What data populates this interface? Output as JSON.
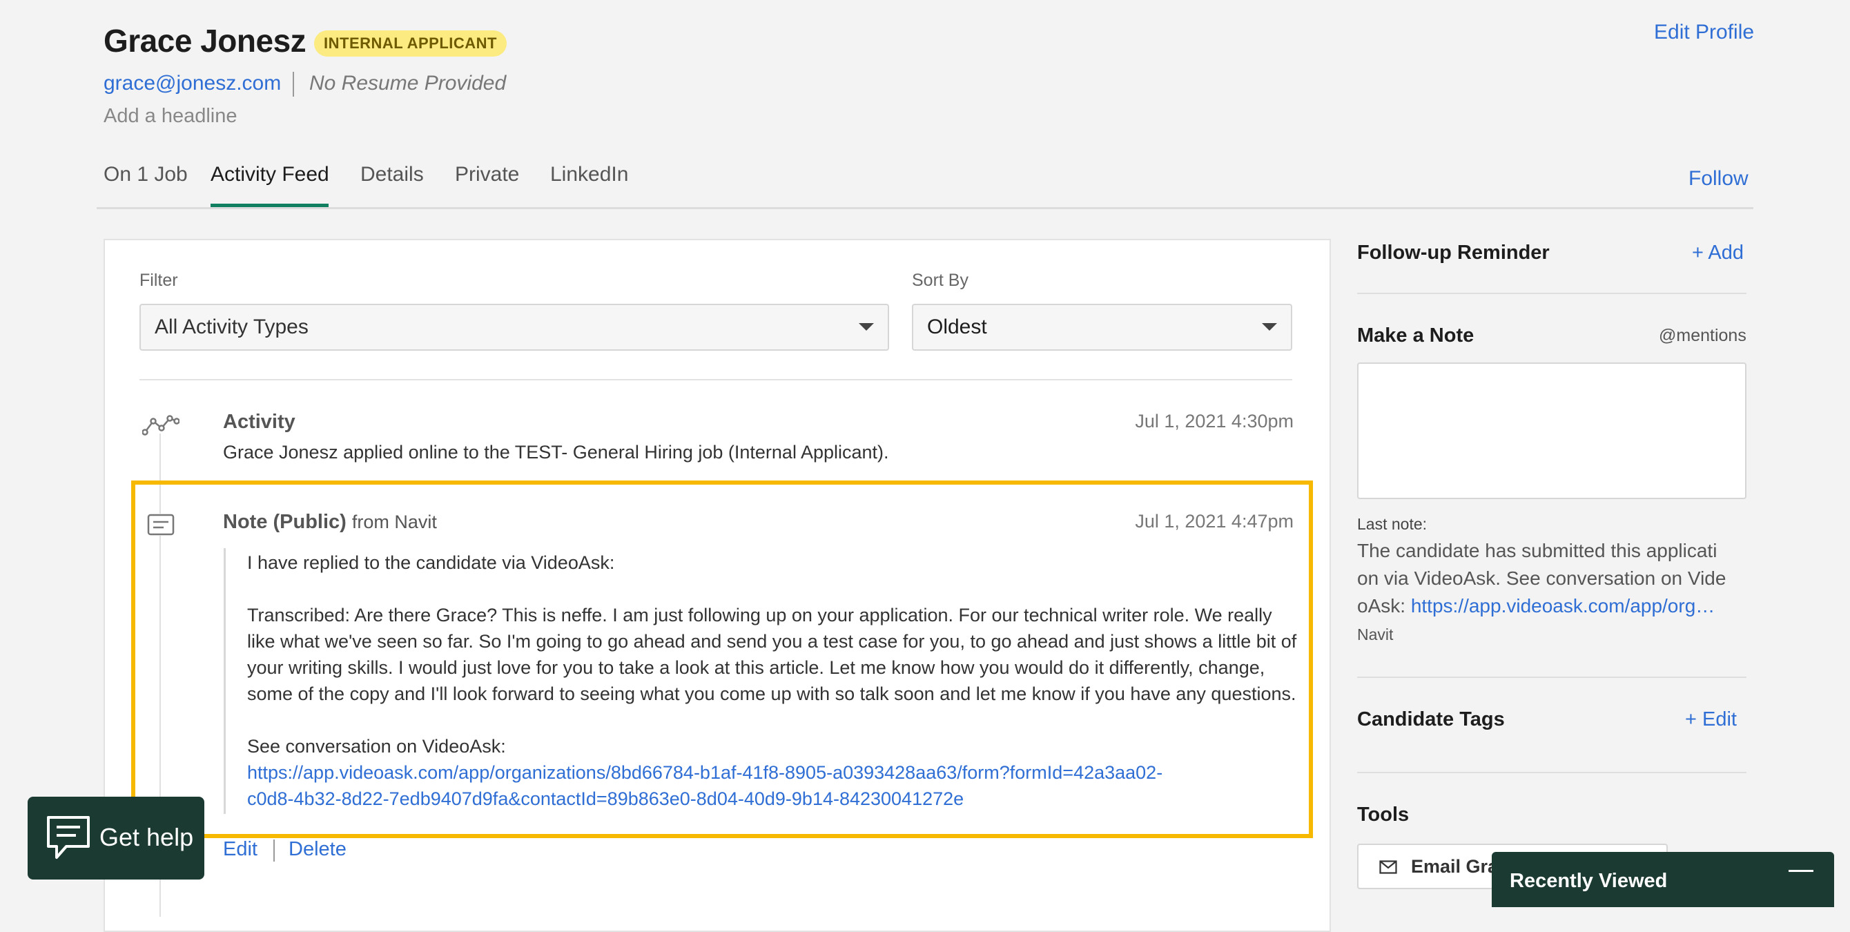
{
  "candidate": {
    "name": "Grace Jonesz",
    "badge": "INTERNAL APPLICANT",
    "email": "grace@jonesz.com",
    "resume_status": "No Resume Provided",
    "headline_placeholder": "Add a headline",
    "edit_profile": "Edit Profile"
  },
  "tabs": [
    {
      "label": "On 1 Job"
    },
    {
      "label": "Activity Feed",
      "active": true
    },
    {
      "label": "Details"
    },
    {
      "label": "Private"
    },
    {
      "label": "LinkedIn"
    }
  ],
  "follow": "Follow",
  "feed": {
    "filter_label": "Filter",
    "filter_value": "All Activity Types",
    "sort_label": "Sort By",
    "sort_value": "Oldest",
    "activity": {
      "title": "Activity",
      "timestamp": "Jul 1, 2021 4:30pm",
      "description": "Grace Jonesz applied online to the TEST- General Hiring job (Internal Applicant)."
    },
    "note": {
      "title": "Note (Public)",
      "from": "from Navit",
      "timestamp": "Jul 1, 2021 4:47pm",
      "lines": [
        "I have replied to the candidate via VideoAsk:",
        "Transcribed: Are there Grace? This is neffe. I am just following up on your application. For our technical writer role. We really",
        "like what we've seen so far. So I'm going to go ahead and send you a test case for you, to go ahead and just shows a little bit of",
        "your writing skills. I would just love for you to take a look at this article. Let me know how you would do it differently, change,",
        "some of the copy and I'll look forward to seeing what you come up with so talk soon and let me know if you have any questions.",
        "See conversation on VideoAsk:"
      ],
      "link_lines": [
        "https://app.videoask.com/app/organizations/8bd66784-b1af-41f8-8905-a0393428aa63/form?formId=42a3aa02-",
        "c0d8-4b32-8d22-7edb9407d9fa&contactId=89b863e0-8d04-40d9-9b14-84230041272e"
      ],
      "edit": "Edit",
      "delete": "Delete"
    }
  },
  "sidebar": {
    "followup_title": "Follow-up Reminder",
    "followup_add": "+ Add",
    "note_title": "Make a Note",
    "mentions": "@mentions",
    "last_note_label": "Last note:",
    "last_note_lines": [
      "The candidate has submitted this applicati",
      "on via VideoAsk. See conversation on Vide",
      "oAsk: "
    ],
    "last_note_link": "https://app.videoask.com/app/org…",
    "last_note_author": "Navit",
    "tags_title": "Candidate Tags",
    "tags_edit": "+ Edit",
    "tools_title": "Tools",
    "email_button": "Email Gra"
  },
  "get_help": "Get help",
  "recently_viewed": "Recently Viewed",
  "colors": {
    "accent_green": "#118060",
    "link_blue": "#2f6ed4",
    "highlight": "#f7b900",
    "badge_bg": "#fbeb80",
    "dark_green": "#1b3a32"
  },
  "icons": [
    "activity-chart-icon",
    "note-icon",
    "caret-down-icon",
    "mail-icon",
    "chat-help-icon",
    "minimize-icon"
  ]
}
